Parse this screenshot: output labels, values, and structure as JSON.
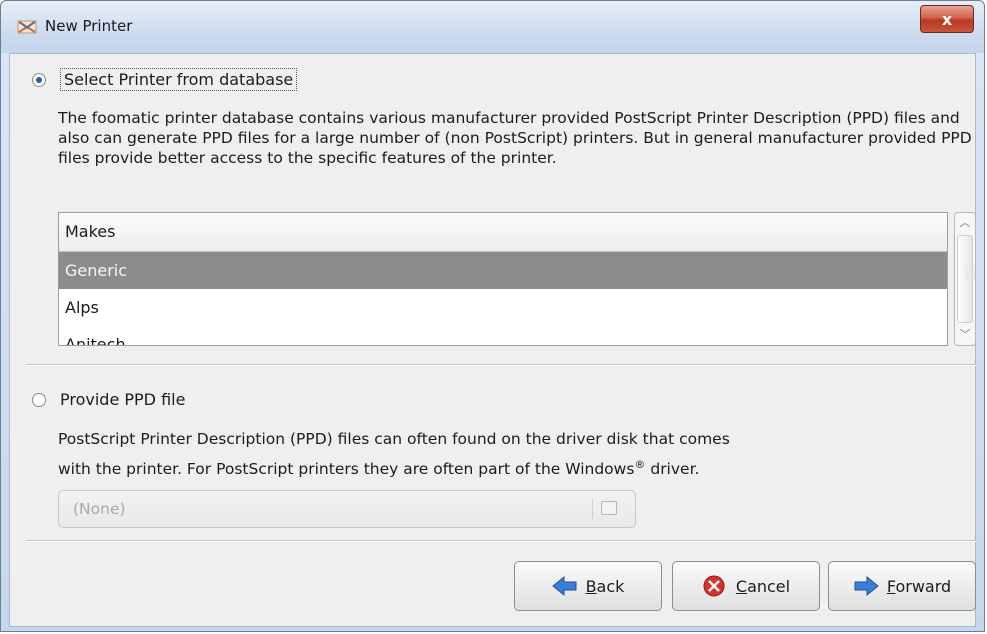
{
  "window": {
    "title": "New Printer",
    "close_label": "x"
  },
  "database_option": {
    "label": "Select Printer from database",
    "selected": true,
    "description": "The foomatic printer database contains various manufacturer provided PostScript Printer Description (PPD) files and also can generate PPD files for a large number of (non PostScript) printers. But in general manufacturer provided PPD files provide better access to the specific features of the printer."
  },
  "makes_list": {
    "header": "Makes",
    "items": [
      "Generic",
      "Alps",
      "Anitech"
    ],
    "selected_index": 0
  },
  "ppd_option": {
    "label": "Provide PPD file",
    "selected": false,
    "description_line1": "PostScript Printer Description (PPD) files can often found on the driver disk that comes",
    "description_line2_prefix": "with the printer. For PostScript printers they are often part of the Windows",
    "description_line2_reg": "®",
    "description_line2_suffix": " driver.",
    "file_chooser_value": "(None)"
  },
  "buttons": {
    "back": "Back",
    "cancel": "Cancel",
    "forward": "Forward"
  }
}
